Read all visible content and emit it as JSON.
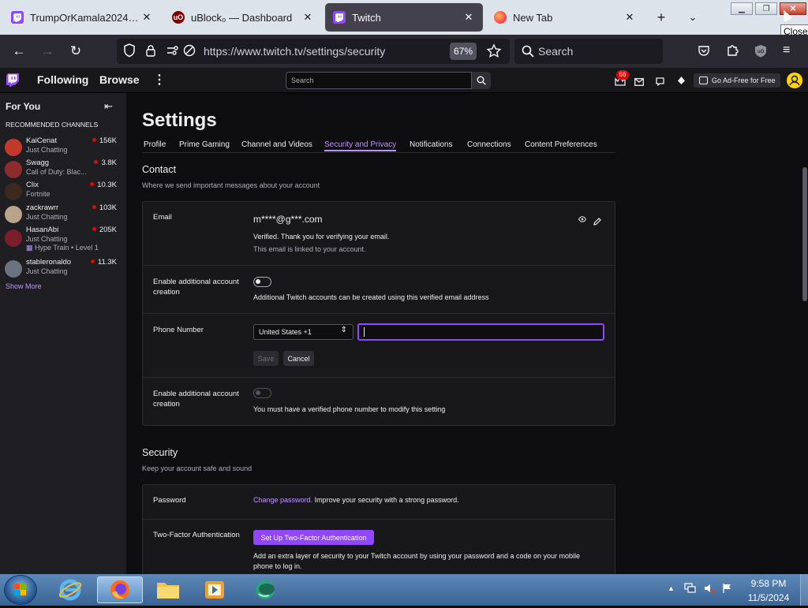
{
  "browser": {
    "tabs": [
      {
        "title": "TrumpOrKamala2024 - Twitch"
      },
      {
        "title": "uBlock₀ — Dashboard"
      },
      {
        "title": "Twitch"
      },
      {
        "title": "New Tab"
      }
    ],
    "tooltip": "Close",
    "url": "https://www.twitch.tv/settings/security",
    "zoom": "67%",
    "search_placeholder": "Search"
  },
  "twitch_nav": {
    "following": "Following",
    "browse": "Browse",
    "search_placeholder": "Search",
    "notification_count": "66",
    "ad_free": "Go Ad-Free for Free"
  },
  "sidebar": {
    "for_you": "For You",
    "section": "RECOMMENDED CHANNELS",
    "channels": [
      {
        "name": "KaiCenat",
        "game": "Just Chatting",
        "viewers": "156K",
        "color": "#c0392b"
      },
      {
        "name": "Swagg",
        "game": "Call of Duty: Blac...",
        "viewers": "3.8K",
        "color": "#8e2b2b"
      },
      {
        "name": "Clix",
        "game": "Fortnite",
        "viewers": "10.3K",
        "color": "#3d2a1f"
      },
      {
        "name": "zackrawrr",
        "game": "Just Chatting",
        "viewers": "103K",
        "color": "#b9a48a"
      },
      {
        "name": "HasanAbi",
        "game": "Just Chatting",
        "viewers": "205K",
        "color": "#7a1f2a",
        "extra": "Hype Train • Level 1"
      },
      {
        "name": "stableronaldo",
        "game": "Just Chatting",
        "viewers": "11.3K",
        "color": "#6b7280"
      }
    ],
    "show_more": "Show More"
  },
  "settings": {
    "title": "Settings",
    "tabs": [
      "Profile",
      "Prime Gaming",
      "Channel and Videos",
      "Security and Privacy",
      "Notifications",
      "Connections",
      "Content Preferences"
    ],
    "active_tab": "Security and Privacy",
    "contact": {
      "heading": "Contact",
      "description": "Where we send important messages about your account",
      "email_label": "Email",
      "email_value": "m****@g***.com",
      "email_verified": "Verified. Thank you for verifying your email.",
      "email_linked": "This email is linked to your account.",
      "enable_label": "Enable additional account creation",
      "enable_email_note": "Additional Twitch accounts can be created using this verified email address",
      "phone_label": "Phone Number",
      "country": "United States +1",
      "phone_value": "",
      "save": "Save",
      "cancel": "Cancel",
      "enable_phone_note": "You must have a verified phone number to modify this setting"
    },
    "security": {
      "heading": "Security",
      "description": "Keep your account safe and sound",
      "password_label": "Password",
      "change_password": "Change password.",
      "password_note": "Improve your security with a strong password.",
      "tfa_label": "Two-Factor Authentication",
      "tfa_button": "Set Up Two-Factor Authentication",
      "tfa_note": "Add an extra layer of security to your Twitch account by using your password and a code on your mobile phone to log in."
    }
  },
  "taskbar": {
    "time": "9:58 PM",
    "date": "11/5/2024"
  },
  "colors": {
    "twitch_purple": "#9147ff",
    "active_tab_link": "#bf94ff",
    "live_red": "#eb0400"
  }
}
